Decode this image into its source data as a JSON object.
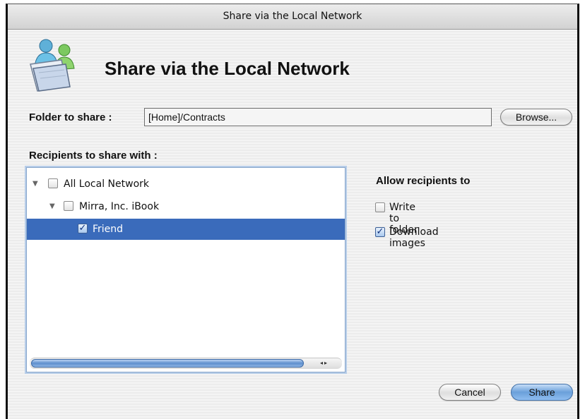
{
  "window": {
    "title": "Share via the Local Network"
  },
  "header": {
    "title": "Share via the Local Network",
    "icon": "shared-folder-people-icon"
  },
  "folder": {
    "label": "Folder to share :",
    "value": "[Home]/Contracts",
    "browse_label": "Browse..."
  },
  "recipients": {
    "label": "Recipients to share with :",
    "items": [
      {
        "label": "All Local Network",
        "level": 0,
        "expanded": true,
        "checked": false,
        "selected": false
      },
      {
        "label": "Mirra, Inc. iBook",
        "level": 1,
        "expanded": true,
        "checked": false,
        "selected": false
      },
      {
        "label": "Friend",
        "level": 2,
        "expanded": false,
        "checked": true,
        "selected": true
      }
    ]
  },
  "permissions": {
    "title": "Allow recipients to",
    "options": [
      {
        "label": "Write to folder",
        "checked": false
      },
      {
        "label": "Download images",
        "checked": true
      }
    ]
  },
  "buttons": {
    "cancel": "Cancel",
    "share": "Share"
  },
  "colors": {
    "selection": "#3a6bbb",
    "default_button": "#6aa0da"
  }
}
